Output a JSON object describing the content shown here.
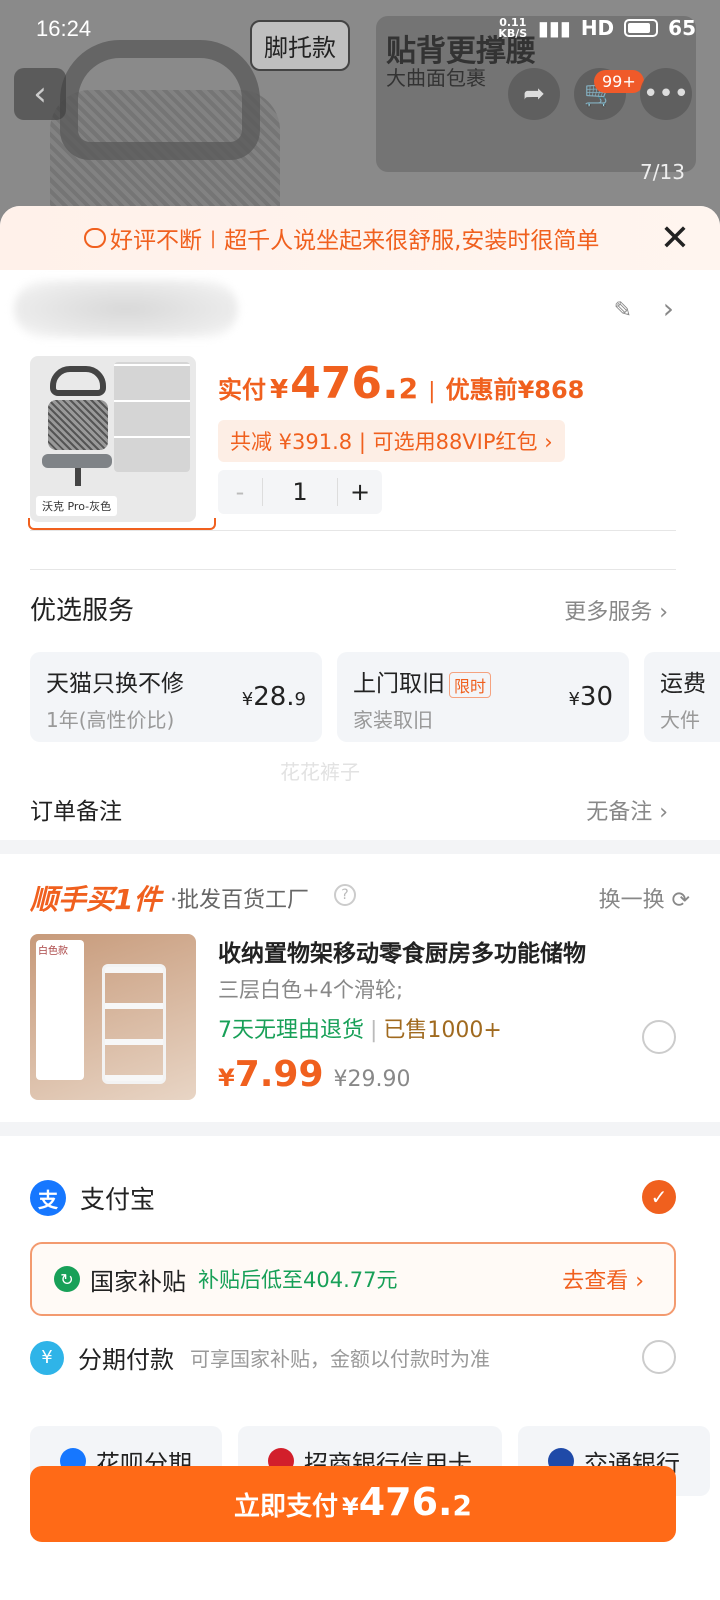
{
  "status_bar": {
    "time": "16:24",
    "net_speed": "0.11 KB/S",
    "signal": "4G 5G",
    "hd": "HD",
    "battery": "65"
  },
  "background": {
    "tag": "脚托款",
    "banner_title": "贴背更撑腰",
    "banner_sub": "大曲面包裹",
    "cart_badge": "99+",
    "image_counter": "7/13"
  },
  "notice": {
    "label": "好评不断",
    "text": "超千人说坐起来很舒服,安装时很简单"
  },
  "product": {
    "thumb_caption": "沃克 Pro-灰色",
    "price_label": "实付",
    "currency": "¥",
    "price_int": "476.",
    "price_dec": "2",
    "pre_label": "优惠前",
    "pre_price": "¥868",
    "discount": "共减 ¥391.8 | 可选用88VIP红包 ›",
    "qty_minus": "-",
    "qty": "1",
    "qty_plus": "+"
  },
  "services": {
    "title": "优选服务",
    "more": "更多服务 ›",
    "items": [
      {
        "name": "天猫只换不修",
        "badge": "",
        "sub": "1年(高性价比)",
        "price_int": "28.",
        "price_dec": "9"
      },
      {
        "name": "上门取旧",
        "badge": "限时",
        "sub": "家装取旧",
        "price_int": "30",
        "price_dec": ""
      },
      {
        "name": "运费",
        "badge": "",
        "sub": "大件",
        "price_int": "",
        "price_dec": ""
      }
    ],
    "watermark": "花花裤子",
    "remark_label": "订单备注",
    "remark_value": "无备注 ›"
  },
  "addon": {
    "logo_a": "顺手买",
    "logo_b": "1件",
    "store": "·批发百货工厂",
    "help": "?",
    "swap": "换一换 ⟳",
    "pic_label": "白色款",
    "title": "收纳置物架移动零食厨房多功能储物",
    "spec": "三层白色+4个滑轮;",
    "return_tag": "7天无理由退货",
    "sold_tag": "已售1000+",
    "price_yen": "¥",
    "price": "7.99",
    "orig_price": "¥29.90"
  },
  "payment": {
    "alipay_label": "支付宝",
    "subsidy_label": "国家补贴",
    "subsidy_text": "补贴后低至404.77元",
    "subsidy_link": "去查看 ›",
    "installment_label": "分期付款",
    "installment_desc": "可享国家补贴，金额以付款时为准",
    "options": [
      "花呗分期",
      "招商银行信用卡",
      "交通银行"
    ]
  },
  "pay_button": {
    "label": "立即支付",
    "yen": "¥",
    "int": "476.",
    "dec": "2"
  },
  "colors": {
    "accent": "#ff6a17",
    "orange_text": "#f0601e",
    "green": "#18a058",
    "alipay": "#1677ff"
  }
}
